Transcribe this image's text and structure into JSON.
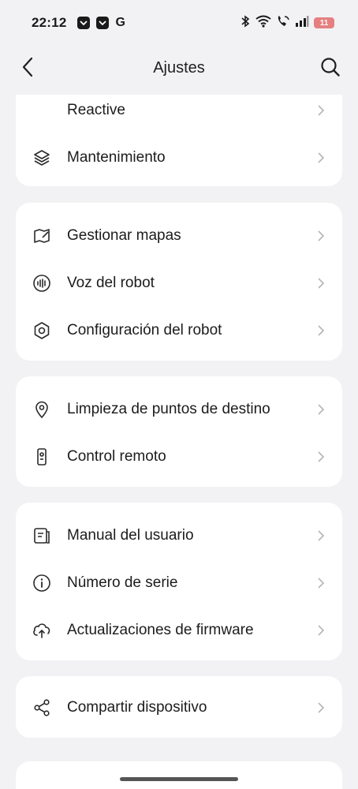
{
  "status_bar": {
    "time": "22:12",
    "g_label": "G",
    "battery": "11",
    "icons": [
      "pocket-notif-icon",
      "pocket-notif-icon",
      "google-icon",
      "bluetooth-icon",
      "wifi-icon",
      "wifi-call-icon",
      "signal-icon",
      "battery-icon"
    ]
  },
  "header": {
    "title": "Ajustes",
    "back_icon": "back-arrow-icon",
    "search_icon": "search-icon"
  },
  "sections": [
    {
      "items": [
        {
          "label": "Reactive",
          "icon": "none"
        },
        {
          "label": "Mantenimiento",
          "icon": "layers-icon"
        }
      ]
    },
    {
      "items": [
        {
          "label": "Gestionar mapas",
          "icon": "map-edit-icon"
        },
        {
          "label": "Voz del robot",
          "icon": "voice-wave-icon"
        },
        {
          "label": "Configuración del robot",
          "icon": "hexagon-settings-icon"
        }
      ]
    },
    {
      "items": [
        {
          "label": "Limpieza de puntos de destino",
          "icon": "location-pin-icon"
        },
        {
          "label": "Control remoto",
          "icon": "remote-control-icon"
        }
      ]
    },
    {
      "items": [
        {
          "label": "Manual del usuario",
          "icon": "manual-book-icon"
        },
        {
          "label": "Número de serie",
          "icon": "info-icon"
        },
        {
          "label": "Actualizaciones de firmware",
          "icon": "cloud-upload-icon"
        }
      ]
    },
    {
      "items": [
        {
          "label": "Compartir dispositivo",
          "icon": "share-icon"
        }
      ]
    }
  ],
  "colors": {
    "background": "#f2f2f4",
    "card": "#ffffff",
    "text": "#1c1c1c",
    "chevron": "#b5b5b8",
    "icon": "#2a2a2a"
  }
}
